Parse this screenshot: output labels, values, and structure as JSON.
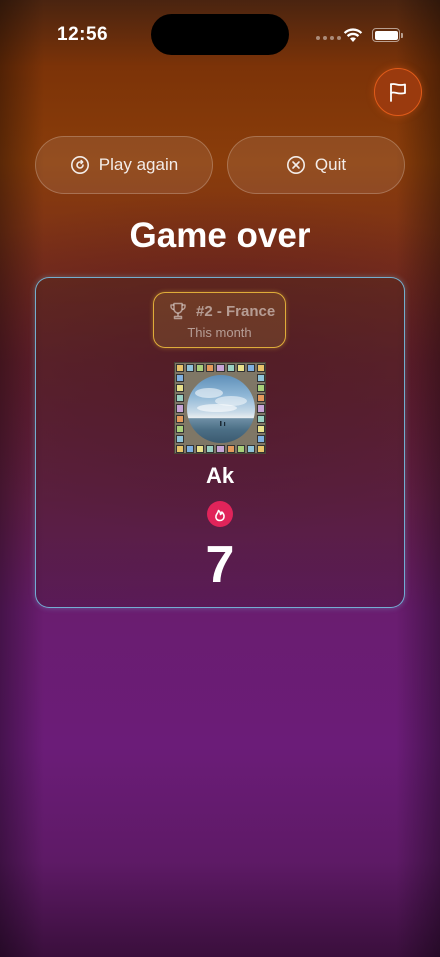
{
  "status_bar": {
    "time": "12:56"
  },
  "header": {
    "flag_icon": "flag-icon"
  },
  "actions": {
    "play_again_label": "Play again",
    "quit_label": "Quit"
  },
  "title": "Game over",
  "result_card": {
    "rank": "#2 - France",
    "period": "This month",
    "username": "Ak",
    "score": "7",
    "streak_icon": "flame-icon"
  },
  "colors": {
    "accent_orange": "#e05b1a",
    "card_border": "#78c8eb",
    "rank_border": "#ebb93c",
    "streak": "#e0245a"
  }
}
